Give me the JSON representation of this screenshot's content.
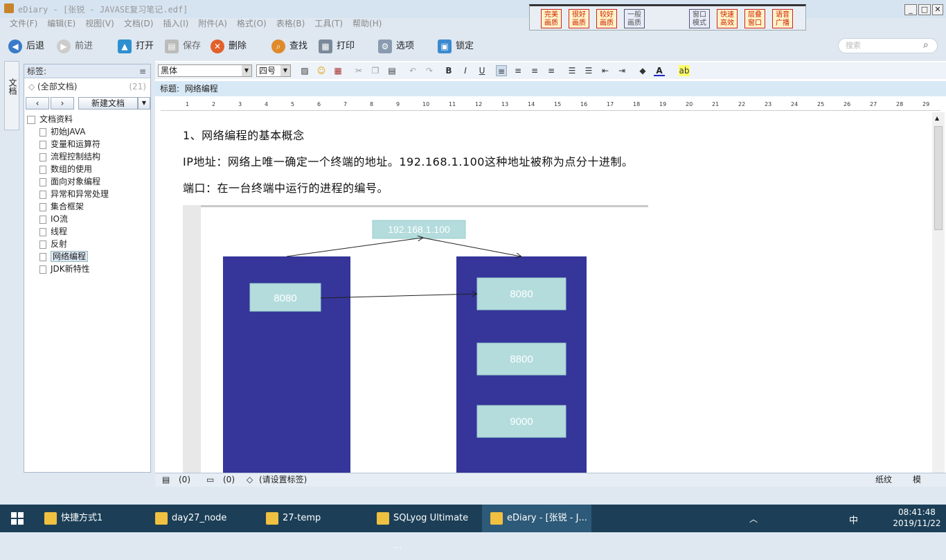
{
  "window": {
    "title": "eDiary - [张锐 - JAVASE复习笔记.edf]"
  },
  "menu": [
    "文件(F)",
    "编辑(E)",
    "视图(V)",
    "文档(D)",
    "插入(I)",
    "附件(A)",
    "格式(O)",
    "表格(B)",
    "工具(T)",
    "帮助(H)"
  ],
  "skins": [
    "完美画质",
    "很好画质",
    "较好画质",
    "一般画质",
    "窗口模式",
    "快速高效",
    "层叠窗口",
    "语音广播"
  ],
  "toolbar": {
    "back": "后退",
    "forward": "前进",
    "open": "打开",
    "save": "保存",
    "delete": "删除",
    "find": "查找",
    "print": "打印",
    "options": "选项",
    "lock": "锁定"
  },
  "search": {
    "placeholder": "搜索"
  },
  "sidebar": {
    "tab_doc": "文档",
    "tags_label": "标签:",
    "all_docs": "(全部文档)",
    "all_docs_count": "(21)",
    "new_doc": "新建文档",
    "root": "文档资料",
    "items": [
      "初始JAVA",
      "变量和运算符",
      "流程控制结构",
      "数组的使用",
      "面向对象编程",
      "异常和异常处理",
      "集合框架",
      "IO流",
      "线程",
      "反射",
      "网络编程",
      "JDK新特性"
    ],
    "selected": "网络编程"
  },
  "format": {
    "font": "黑体",
    "size": "四号"
  },
  "doc": {
    "title_label": "标题:",
    "title": "网络编程",
    "p1": "1、网络编程的基本概念",
    "p2": "IP地址：网络上唯一确定一个终端的地址。192.168.1.100这种地址被称为点分十进制。",
    "p3": "端口：在一台终端中运行的进程的编号。"
  },
  "diagram": {
    "ip": "192.168.1.100",
    "left_port": "8080",
    "right_ports": [
      "8080",
      "8800",
      "9000"
    ],
    "box_color": "#35359a",
    "port_color": "#b4dcdc"
  },
  "status": {
    "a": "(0)",
    "b": "(0)",
    "tag": "(请设置标签)",
    "paper": "纸纹",
    "mode": "模"
  },
  "taskbar": {
    "items": [
      "快捷方式1",
      "day27_node",
      "27-temp",
      "SQLyog Ultimate ...",
      "eDiary - [张锐 - J..."
    ],
    "time": "08:41:48",
    "date": "2019/11/22",
    "ime": "中"
  }
}
